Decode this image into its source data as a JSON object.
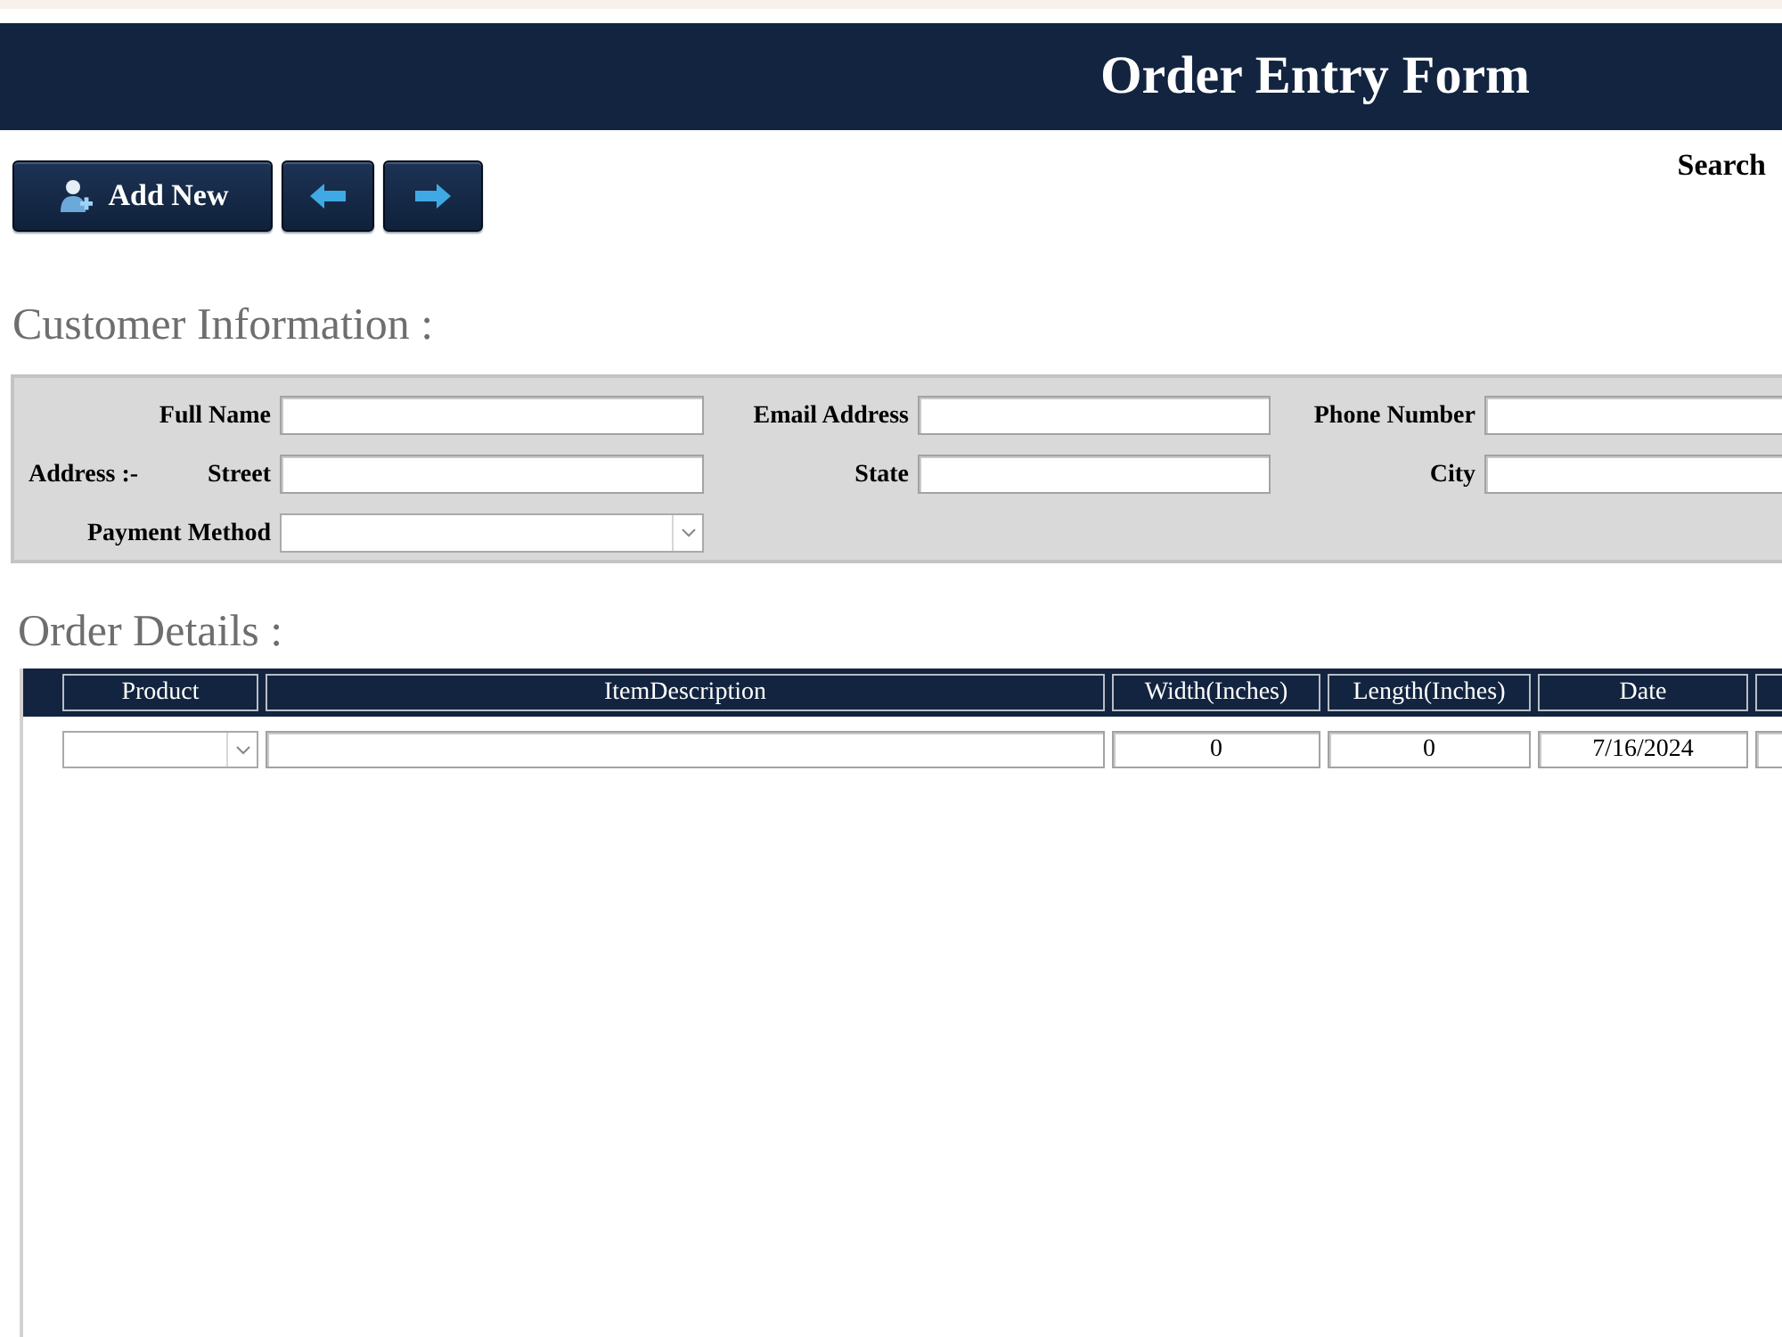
{
  "header": {
    "title": "Order Entry Form"
  },
  "toolbar": {
    "buttons": [
      {
        "kind": "add",
        "label": "Add New"
      },
      {
        "kind": "previous"
      },
      {
        "kind": "next"
      }
    ],
    "search_label": "Search"
  },
  "customer_information": {
    "heading": "Customer Information :",
    "rows": [
      {
        "fields": [
          {
            "label": "Full Name",
            "kind": "text"
          },
          {
            "label": "Email Address",
            "kind": "text"
          },
          {
            "label": "Phone Number",
            "kind": "text"
          }
        ]
      },
      {
        "group_label": "Address :-",
        "fields": [
          {
            "label": "Street",
            "kind": "text"
          },
          {
            "label": "State",
            "kind": "text"
          },
          {
            "label": "City",
            "kind": "text"
          }
        ]
      },
      {
        "fields": [
          {
            "label": "Payment Method",
            "kind": "select"
          }
        ]
      }
    ]
  },
  "order_details": {
    "heading": "Order Details :",
    "table": {
      "columns": [
        "Product",
        "ItemDescription",
        "Width(Inches)",
        "Length(Inches)",
        "Date"
      ],
      "rows": [
        {
          "cells": [
            {
              "kind": "select"
            },
            {
              "kind": "text"
            },
            {
              "kind": "text",
              "value": "0"
            },
            {
              "kind": "text",
              "value": "0"
            },
            {
              "kind": "text",
              "value": "7/16/2024"
            },
            {
              "kind": "text"
            }
          ]
        }
      ]
    }
  }
}
